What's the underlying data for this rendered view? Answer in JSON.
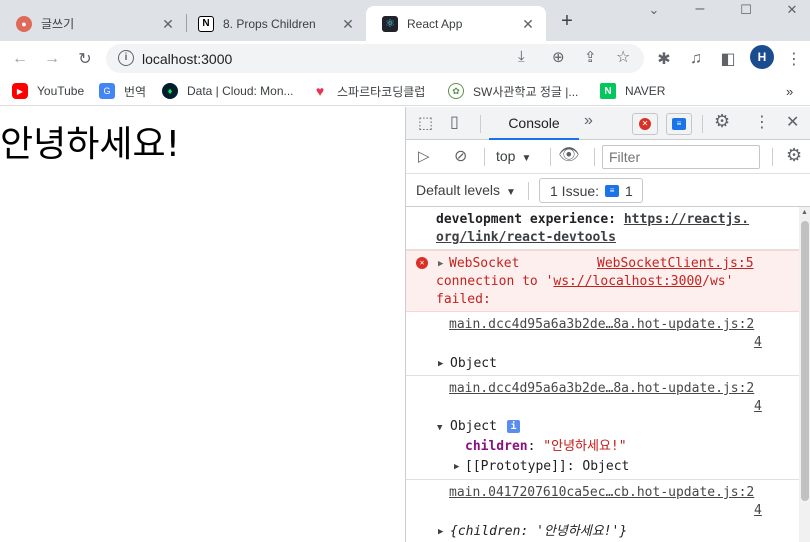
{
  "tabs": [
    {
      "title": "글쓰기",
      "icon": "brunch-icon"
    },
    {
      "title": "8. Props Children",
      "icon": "notion-icon"
    },
    {
      "title": "React App",
      "icon": "react-icon"
    }
  ],
  "toolbar": {
    "url": "localhost:3000",
    "avatar_letter": "H"
  },
  "bookmarks": [
    {
      "label": "YouTube",
      "icon": "youtube-icon"
    },
    {
      "label": "번역",
      "icon": "translate-icon"
    },
    {
      "label": "Data | Cloud: Mon...",
      "icon": "mongodb-icon"
    },
    {
      "label": "스파르타코딩클럽",
      "icon": "sparta-icon"
    },
    {
      "label": "SW사관학교 정글 |...",
      "icon": "jungle-icon"
    },
    {
      "label": "NAVER",
      "icon": "naver-icon"
    }
  ],
  "page": {
    "greeting": "안녕하세요!"
  },
  "devtools": {
    "console_tab": "Console",
    "context": "top",
    "filter_placeholder": "Filter",
    "levels": "Default levels",
    "issue_label": "1 Issue:",
    "issue_count": "1",
    "log": {
      "e1_line1": "development experience: ",
      "e1_link1": "https://reactjs.",
      "e1_link2": "org/link/react-devtools",
      "e2_line1": "WebSocket",
      "e2_source": "WebSocketClient.js:5",
      "e2_line2a": "connection to '",
      "e2_url": "ws://localhost:3000",
      "e2_line2b": "/ws'",
      "e2_line3": "failed:",
      "e3_source1": "main.dcc4d95a6a3b2de…8a.hot-update.js:2",
      "e3_source2": "4",
      "e4_object": "Object",
      "e5_source1": "main.dcc4d95a6a3b2de…8a.hot-update.js:2",
      "e5_source2": "4",
      "e6_object": "Object",
      "e6_key": "children",
      "e6_value": "\"안녕하세요!\"",
      "e6_proto": "[[Prototype]]: Object",
      "e7_source1": "main.0417207610ca5ec…cb.hot-update.js:2",
      "e7_source2": "4",
      "e8_inline": "{children: '안녕하세요!'}"
    }
  },
  "colors": {
    "tabstrip": "#dee1e6",
    "error_bg": "#fcefee",
    "error_text": "#c5221f",
    "accent": "#1a73e8"
  }
}
